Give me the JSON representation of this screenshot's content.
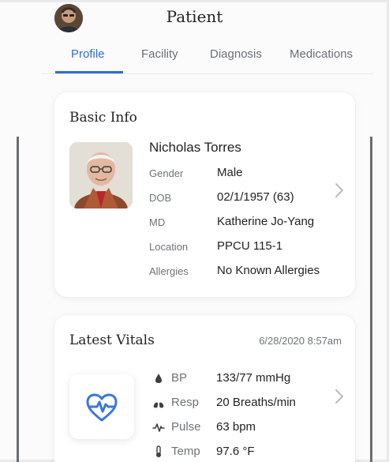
{
  "header": {
    "title": "Patient"
  },
  "tabs": [
    {
      "label": "Profile",
      "active": true
    },
    {
      "label": "Facility",
      "active": false
    },
    {
      "label": "Diagnosis",
      "active": false
    },
    {
      "label": "Medications",
      "active": false
    }
  ],
  "basic_info": {
    "title": "Basic Info",
    "name": "Nicholas Torres",
    "fields": [
      {
        "label": "Gender",
        "value": "Male"
      },
      {
        "label": "DOB",
        "value": "02/1/1957 (63)"
      },
      {
        "label": "MD",
        "value": "Katherine Jo-Yang"
      },
      {
        "label": "Location",
        "value": "PPCU 115-1"
      },
      {
        "label": "Allergies",
        "value": "No Known Allergies"
      }
    ]
  },
  "vitals": {
    "title": "Latest Vitals",
    "timestamp": "6/28/2020 8:57am",
    "items": [
      {
        "icon": "blood-drop-icon",
        "label": "BP",
        "value": "133/77 mmHg"
      },
      {
        "icon": "lungs-icon",
        "label": "Resp",
        "value": "20 Breaths/min"
      },
      {
        "icon": "pulse-wave-icon",
        "label": "Pulse",
        "value": "63 bpm"
      },
      {
        "icon": "thermometer-icon",
        "label": "Temp",
        "value": "97.6 °F"
      }
    ]
  },
  "colors": {
    "accent": "#2f6bd6",
    "text": "#222222",
    "muted": "#6f7278",
    "chevron": "#b8bbc0"
  }
}
